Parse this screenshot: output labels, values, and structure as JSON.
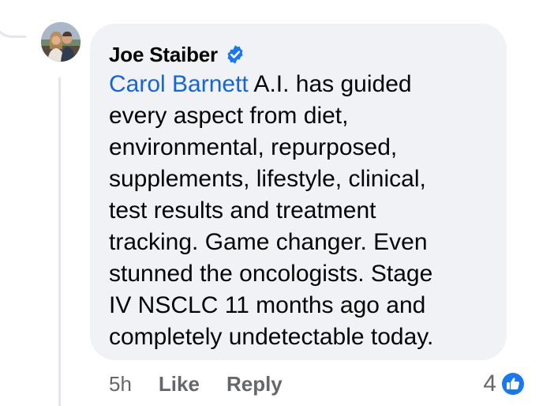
{
  "comment": {
    "author": "Joe Staiber",
    "author_verified": true,
    "mention": "Carol Barnett",
    "lines": [
      " A.I. has guided",
      "every aspect from diet,",
      "environmental, repurposed,",
      "supplements, lifestyle, clinical,",
      "test results and treatment",
      "tracking.  Game changer.  Even",
      "stunned the oncologists.  Stage",
      "IV NSCLC 11 months ago and",
      "completely undetectable today."
    ],
    "timestamp": "5h",
    "like_label": "Like",
    "reply_label": "Reply",
    "reaction_count": "4",
    "reaction_icon": "like-thumbs-up-icon"
  },
  "colors": {
    "bubble_background": "#f0f2f5",
    "mention": "#1466d6",
    "verified_badge": "#1877f2",
    "like_badge": "#1877f2",
    "muted_text": "#65676b",
    "primary_text": "#050505",
    "thread_line": "#e4e6eb"
  }
}
